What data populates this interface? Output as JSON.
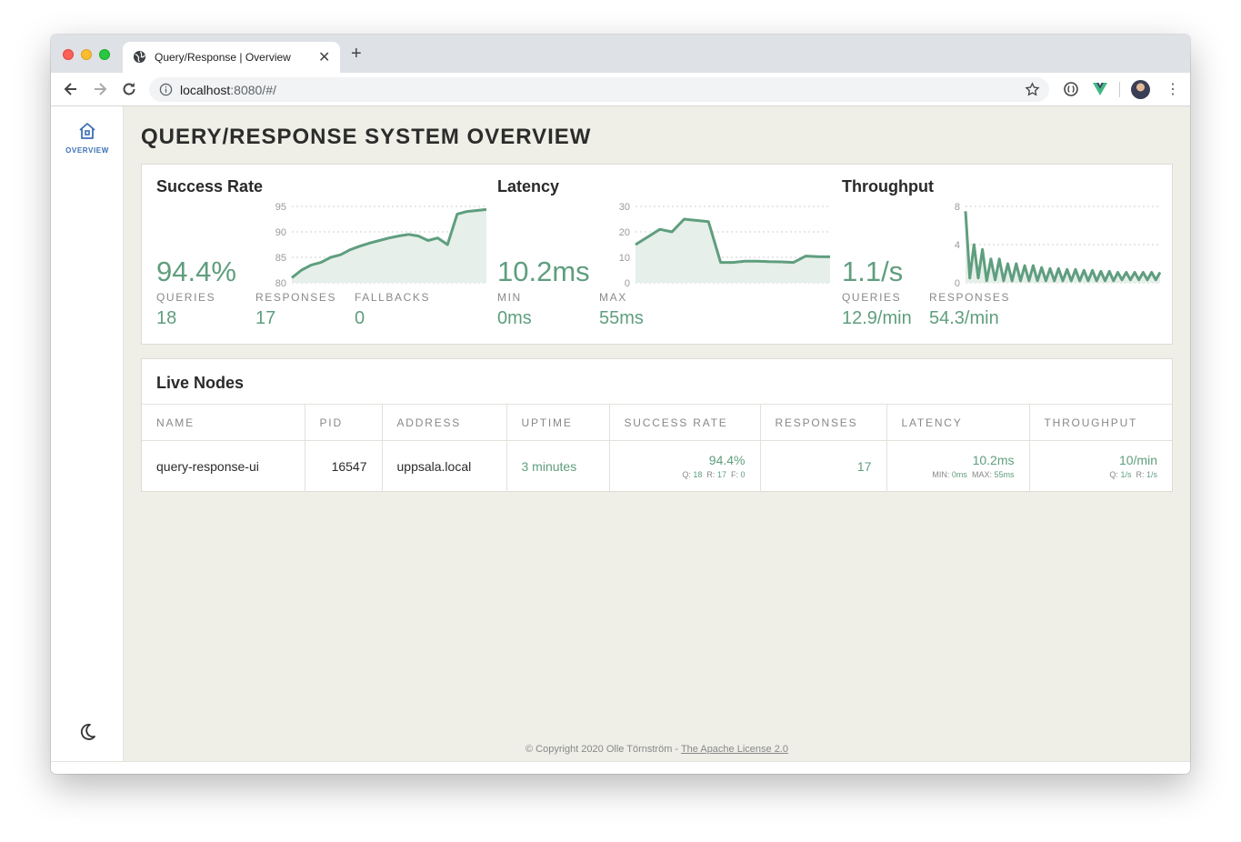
{
  "browser": {
    "tab_title": "Query/Response | Overview",
    "url_host": "localhost",
    "url_rest": ":8080/#/"
  },
  "sidebar": {
    "overview_label": "OVERVIEW"
  },
  "page": {
    "title": "QUERY/RESPONSE SYSTEM OVERVIEW"
  },
  "success": {
    "title": "Success Rate",
    "value": "94.4%",
    "queries_label": "QUERIES",
    "queries": "18",
    "responses_label": "RESPONSES",
    "responses": "17",
    "fallbacks_label": "FALLBACKS",
    "fallbacks": "0"
  },
  "latency": {
    "title": "Latency",
    "value": "10.2ms",
    "min_label": "MIN",
    "min": "0ms",
    "max_label": "MAX",
    "max": "55ms"
  },
  "throughput": {
    "title": "Throughput",
    "value": "1.1/s",
    "queries_label": "QUERIES",
    "queries": "12.9/min",
    "responses_label": "RESPONSES",
    "responses": "54.3/min"
  },
  "nodes": {
    "title": "Live Nodes",
    "columns": [
      "NAME",
      "PID",
      "ADDRESS",
      "UPTIME",
      "SUCCESS RATE",
      "RESPONSES",
      "LATENCY",
      "THROUGHPUT"
    ],
    "rows": [
      {
        "name": "query-response-ui",
        "pid": "16547",
        "address": "uppsala.local",
        "uptime": "3 minutes",
        "success_rate": "94.4%",
        "sr_q_label": "Q:",
        "sr_q": "18",
        "sr_r_label": "R:",
        "sr_r": "17",
        "sr_f_label": "F:",
        "sr_f": "0",
        "responses": "17",
        "latency": "10.2ms",
        "lat_min_label": "MIN:",
        "lat_min": "0ms",
        "lat_max_label": "MAX:",
        "lat_max": "55ms",
        "throughput": "10/min",
        "tp_q_label": "Q:",
        "tp_q": "1/s",
        "tp_r_label": "R:",
        "tp_r": "1/s"
      }
    ]
  },
  "footer": {
    "copyright": "© Copyright 2020 Olle Törnström -",
    "license_link": "The Apache License 2.0"
  },
  "theme": {
    "accent": "#5f9e7e",
    "accent_fill": "#e6efe9",
    "nav_blue": "#3b6fb6",
    "background": "#efefe8"
  },
  "chart_data": [
    {
      "type": "area",
      "ylim": [
        80,
        95
      ],
      "yticks": [
        "95",
        "90",
        "85",
        "80"
      ],
      "values": [
        81,
        82.5,
        83.5,
        84,
        85,
        85.5,
        86.5,
        87.2,
        87.8,
        88.3,
        88.8,
        89.2,
        89.5,
        89.2,
        88.3,
        88.8,
        87.5,
        93.5,
        94,
        94.2,
        94.4
      ]
    },
    {
      "type": "area",
      "ylim": [
        0,
        30
      ],
      "yticks": [
        "30",
        "20",
        "10",
        "0"
      ],
      "values": [
        15,
        18,
        21,
        20,
        25,
        24.5,
        24,
        8,
        8,
        8.5,
        8.5,
        8.3,
        8.2,
        8,
        10.5,
        10.3,
        10.2
      ]
    },
    {
      "type": "area",
      "ylim": [
        0,
        8
      ],
      "yticks": [
        "8",
        "4",
        "0"
      ],
      "values": [
        7.5,
        0.5,
        4,
        0.5,
        3.5,
        0.2,
        2.5,
        0.3,
        2.5,
        0.2,
        2,
        0.2,
        2,
        0.2,
        1.8,
        0.2,
        1.8,
        0.2,
        1.6,
        0.2,
        1.5,
        0.2,
        1.5,
        0.2,
        1.4,
        0.2,
        1.4,
        0.2,
        1.3,
        0.2,
        1.3,
        0.2,
        1.2,
        0.2,
        1.2,
        0.2,
        1.1,
        0.3,
        1.1,
        0.3,
        1.1,
        0.3,
        1.1,
        0.3,
        1.1,
        0.3,
        1.1
      ]
    }
  ]
}
